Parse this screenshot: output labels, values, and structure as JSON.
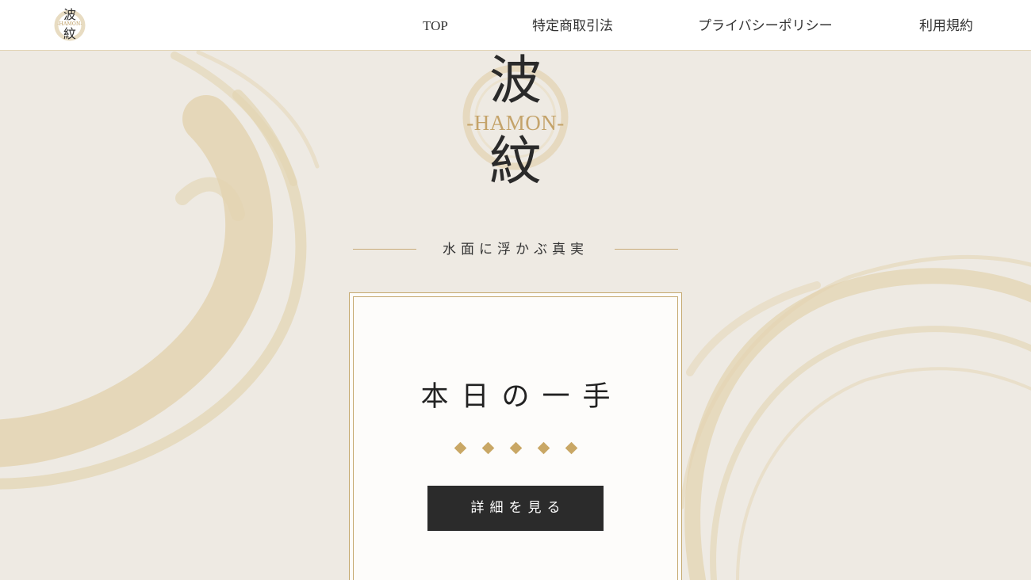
{
  "header": {
    "logo": {
      "kanji_top": "波",
      "roman": "-HAMON-",
      "kanji_bottom": "紋"
    },
    "nav": [
      {
        "label": "TOP"
      },
      {
        "label": "特定商取引法"
      },
      {
        "label": "プライバシーポリシー"
      },
      {
        "label": "利用規約"
      }
    ]
  },
  "hero": {
    "logo": {
      "kanji_top": "波",
      "roman": "-HAMON-",
      "kanji_bottom": "紋"
    },
    "tagline": "水面に浮かぶ真実"
  },
  "card": {
    "title": "本日の一手",
    "rating": {
      "value": 5,
      "max": 5,
      "icon": "diamond-icon"
    },
    "button_label": "詳細を見る"
  },
  "colors": {
    "accent_gold": "#c9a765",
    "dark": "#2b2b2b",
    "background": "#eeeae3",
    "brush": "#e2d3b0"
  }
}
